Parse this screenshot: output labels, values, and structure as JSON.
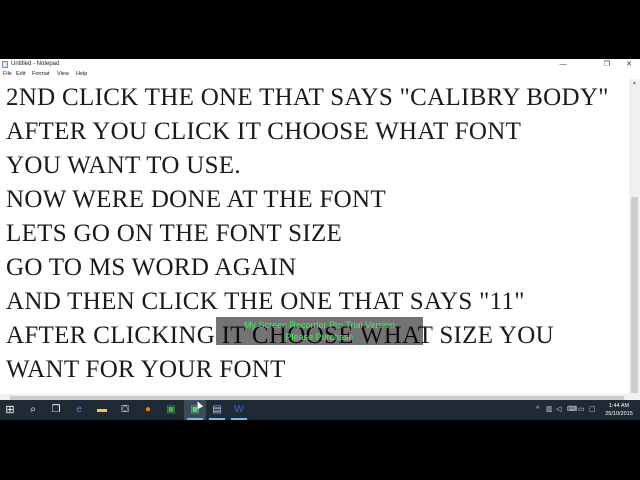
{
  "window": {
    "title": "Untitled - Notepad",
    "minimize_label": "—",
    "maximize_label": "❐",
    "close_label": "✕"
  },
  "menu": [
    "File",
    "Edit",
    "Format",
    "View",
    "Help"
  ],
  "document": {
    "lines": [
      "2ND CLICK THE ONE THAT SAYS \"CALIBRY BODY\" ",
      "AFTER YOU CLICK IT CHOOSE WHAT FONT",
      "YOU WANT TO USE.",
      "NOW WERE DONE AT THE FONT",
      "LETS GO ON THE FONT SIZE",
      "GO TO MS WORD AGAIN",
      "AND THEN CLICK THE ONE THAT SAYS \"11\"",
      "AFTER CLICKING IT CHOOSE WHAT SIZE YOU",
      "WANT FOR YOUR FONT"
    ]
  },
  "watermark": {
    "line1": "My Screen Recorder Pro Trial Version",
    "line2": "Please Purchase",
    "color": "#3ef05a"
  },
  "taskbar": {
    "icons": [
      "windows-logo-icon",
      "search-icon",
      "task-view-icon",
      "edge-icon",
      "file-explorer-icon",
      "store-icon",
      "firefox-icon",
      "photos-icon",
      "recorder-icon",
      "notepad-icon",
      "word-icon"
    ],
    "clock_time": "1:44 AM",
    "clock_date": "25/10/2015",
    "accent": "#76b9ed"
  }
}
